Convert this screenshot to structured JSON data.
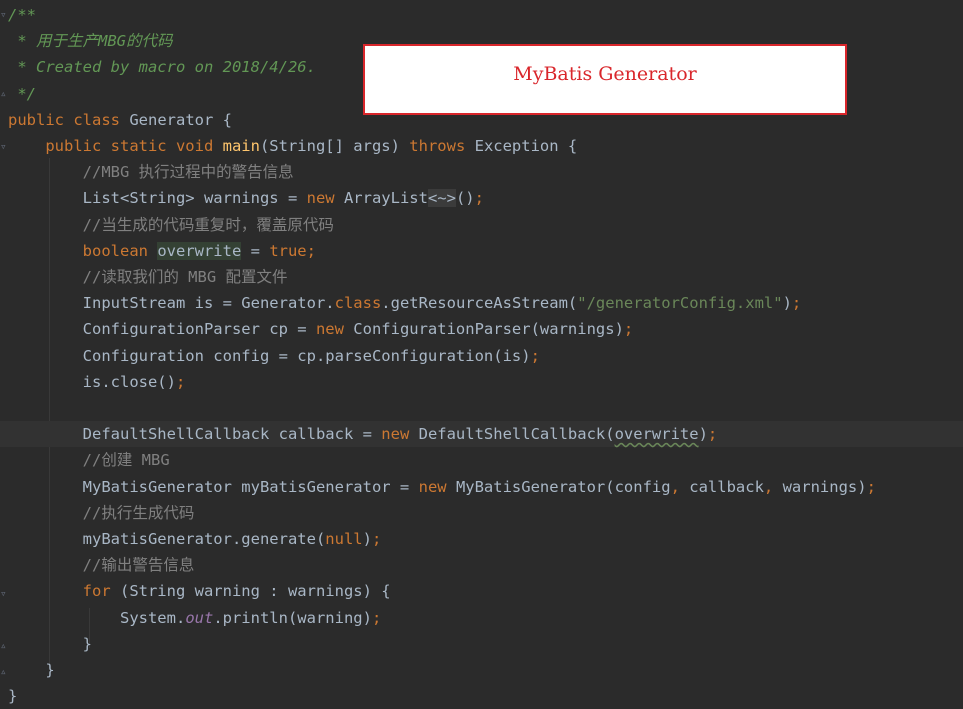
{
  "code": {
    "lines": [
      {
        "id": 1,
        "segments": [
          {
            "c": "doc",
            "t": "/**"
          }
        ]
      },
      {
        "id": 2,
        "segments": [
          {
            "c": "doc",
            "t": " * 用于生产MBG的代码"
          }
        ]
      },
      {
        "id": 3,
        "segments": [
          {
            "c": "doc",
            "t": " * Created by macro on 2018/4/26."
          }
        ]
      },
      {
        "id": 4,
        "segments": [
          {
            "c": "doc",
            "t": " */"
          }
        ]
      },
      {
        "id": 5,
        "segments": [
          {
            "c": "kw",
            "t": "public class "
          },
          {
            "c": "plain",
            "t": "Generator {"
          }
        ]
      },
      {
        "id": 6,
        "segments": [
          {
            "c": "plain",
            "t": "    "
          },
          {
            "c": "kw",
            "t": "public static void "
          },
          {
            "c": "fn",
            "t": "main"
          },
          {
            "c": "plain",
            "t": "(String[] args) "
          },
          {
            "c": "kw",
            "t": "throws "
          },
          {
            "c": "plain",
            "t": "Exception {"
          }
        ]
      },
      {
        "id": 7,
        "segments": [
          {
            "c": "plain",
            "t": "        "
          },
          {
            "c": "cmt",
            "t": "//MBG 执行过程中的警告信息"
          }
        ]
      },
      {
        "id": 8,
        "segments": [
          {
            "c": "plain",
            "t": "        List<String> warnings = "
          },
          {
            "c": "kw",
            "t": "new "
          },
          {
            "c": "plain",
            "t": "ArrayList"
          },
          {
            "c": "diamond",
            "t": "<~>"
          },
          {
            "c": "plain",
            "t": "()"
          },
          {
            "c": "punc",
            "t": ";"
          }
        ]
      },
      {
        "id": 9,
        "segments": [
          {
            "c": "plain",
            "t": "        "
          },
          {
            "c": "cmt",
            "t": "//当生成的代码重复时，覆盖原代码"
          }
        ]
      },
      {
        "id": 10,
        "segments": [
          {
            "c": "plain",
            "t": "        "
          },
          {
            "c": "kw",
            "t": "boolean "
          },
          {
            "c": "ovw-hl",
            "t": "overwrite"
          },
          {
            "c": "plain",
            "t": " = "
          },
          {
            "c": "kw",
            "t": "true;"
          }
        ]
      },
      {
        "id": 11,
        "segments": [
          {
            "c": "plain",
            "t": "        "
          },
          {
            "c": "cmt",
            "t": "//读取我们的 MBG 配置文件"
          }
        ]
      },
      {
        "id": 12,
        "segments": [
          {
            "c": "plain",
            "t": "        InputStream is = Generator."
          },
          {
            "c": "kw",
            "t": "class"
          },
          {
            "c": "plain",
            "t": ".getResourceAsStream("
          },
          {
            "c": "str",
            "t": "\"/generatorConfig.xml\""
          },
          {
            "c": "plain",
            "t": ")"
          },
          {
            "c": "punc",
            "t": ";"
          }
        ]
      },
      {
        "id": 13,
        "segments": [
          {
            "c": "plain",
            "t": "        ConfigurationParser cp = "
          },
          {
            "c": "kw",
            "t": "new "
          },
          {
            "c": "plain",
            "t": "ConfigurationParser(warnings)"
          },
          {
            "c": "punc",
            "t": ";"
          }
        ]
      },
      {
        "id": 14,
        "segments": [
          {
            "c": "plain",
            "t": "        Configuration config = cp.parseConfiguration(is)"
          },
          {
            "c": "punc",
            "t": ";"
          }
        ]
      },
      {
        "id": 15,
        "segments": [
          {
            "c": "plain",
            "t": "        is.close()"
          },
          {
            "c": "punc",
            "t": ";"
          }
        ]
      },
      {
        "id": 16,
        "segments": [
          {
            "c": "plain",
            "t": ""
          }
        ]
      },
      {
        "id": 17,
        "segments": [
          {
            "c": "plain",
            "t": "        DefaultShellCallback callback = "
          },
          {
            "c": "kw",
            "t": "new "
          },
          {
            "c": "plain",
            "t": "DefaultShellCallback("
          },
          {
            "c": "warn-ul",
            "t": "overwrite"
          },
          {
            "c": "plain",
            "t": ")"
          },
          {
            "c": "punc",
            "t": ";"
          }
        ]
      },
      {
        "id": 18,
        "segments": [
          {
            "c": "plain",
            "t": "        "
          },
          {
            "c": "cmt",
            "t": "//创建 MBG"
          }
        ]
      },
      {
        "id": 19,
        "segments": [
          {
            "c": "plain",
            "t": "        MyBatisGenerator myBatisGenerator = "
          },
          {
            "c": "kw",
            "t": "new "
          },
          {
            "c": "plain",
            "t": "MyBatisGenerator(config"
          },
          {
            "c": "punc",
            "t": ", "
          },
          {
            "c": "plain",
            "t": "callback"
          },
          {
            "c": "punc",
            "t": ", "
          },
          {
            "c": "plain",
            "t": "warnings)"
          },
          {
            "c": "punc",
            "t": ";"
          }
        ]
      },
      {
        "id": 20,
        "segments": [
          {
            "c": "plain",
            "t": "        "
          },
          {
            "c": "cmt",
            "t": "//执行生成代码"
          }
        ]
      },
      {
        "id": 21,
        "segments": [
          {
            "c": "plain",
            "t": "        myBatisGenerator.generate("
          },
          {
            "c": "kw",
            "t": "null"
          },
          {
            "c": "plain",
            "t": ")"
          },
          {
            "c": "punc",
            "t": ";"
          }
        ]
      },
      {
        "id": 22,
        "segments": [
          {
            "c": "plain",
            "t": "        "
          },
          {
            "c": "cmt",
            "t": "//输出警告信息"
          }
        ]
      },
      {
        "id": 23,
        "segments": [
          {
            "c": "plain",
            "t": "        "
          },
          {
            "c": "kw",
            "t": "for "
          },
          {
            "c": "plain",
            "t": "(String warning : warnings) {"
          }
        ]
      },
      {
        "id": 24,
        "segments": [
          {
            "c": "plain",
            "t": "            System."
          },
          {
            "c": "static-field",
            "t": "out"
          },
          {
            "c": "plain",
            "t": ".println(warning)"
          },
          {
            "c": "punc",
            "t": ";"
          }
        ]
      },
      {
        "id": 25,
        "segments": [
          {
            "c": "plain",
            "t": "        }"
          }
        ]
      },
      {
        "id": 26,
        "segments": [
          {
            "c": "plain",
            "t": "    }"
          }
        ]
      },
      {
        "id": 27,
        "segments": [
          {
            "c": "plain",
            "t": "}"
          }
        ]
      }
    ],
    "current_line": 17
  },
  "annotation": {
    "label": "MyBatis Generator",
    "border_color": "#d9262b"
  },
  "gutter_icons": [
    "fold-icon",
    "fold-icon",
    "fold-icon",
    "fold-icon",
    "fold-icon",
    "fold-icon"
  ]
}
